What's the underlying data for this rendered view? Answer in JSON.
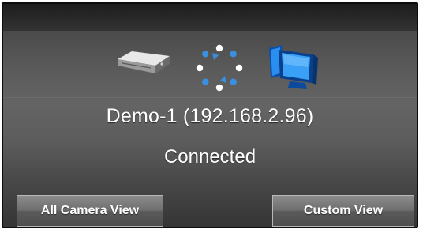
{
  "device": {
    "name": "Demo-1 (192.168.2.96)",
    "status": "Connected"
  },
  "icons": {
    "device": "network-device-icon",
    "sync": "sync-icon",
    "monitor": "monitor-icon"
  },
  "buttons": {
    "all_camera_view": "All Camera View",
    "custom_view": "Custom View"
  },
  "colors": {
    "sync_blue": "#3a8fe0",
    "monitor_blue": "#1d6fd6",
    "text": "#ffffff"
  }
}
